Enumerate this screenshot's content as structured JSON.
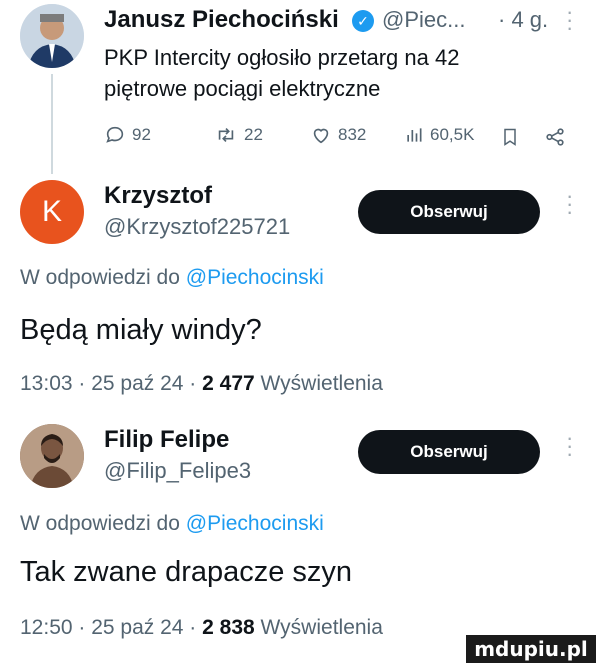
{
  "post1": {
    "author_name": "Janusz Piechociński",
    "handle": "@Piec...",
    "time": "· 4 g.",
    "text": "PKP Intercity ogłosiło przetarg na 42 piętrowe pociągi elektryczne",
    "replies": "92",
    "reposts": "22",
    "likes": "832",
    "views": "60,5K"
  },
  "reply1": {
    "avatar_letter": "K",
    "author_name": "Krzysztof",
    "handle": "@Krzysztof225721",
    "follow_label": "Obserwuj",
    "reply_prefix": "W odpowiedzi do",
    "reply_to": "@Piechocinski",
    "text": "Będą miały windy?",
    "time": "13:03 · 25 paź 24 ·",
    "views_count": "2 477",
    "views_label": "Wyświetlenia"
  },
  "reply2": {
    "author_name": "Filip Felipe",
    "handle": "@Filip_Felipe3",
    "follow_label": "Obserwuj",
    "reply_prefix": "W odpowiedzi do",
    "reply_to": "@Piechocinski",
    "text": "Tak zwane drapacze szyn",
    "time": "12:50 · 25 paź 24 ·",
    "views_count": "2 838",
    "views_label": "Wyświetlenia"
  },
  "watermark": "mdupiu.pl",
  "colors": {
    "accent": "#1d9bf0",
    "avatar_k": "#e8531e",
    "button": "#0f1419"
  }
}
